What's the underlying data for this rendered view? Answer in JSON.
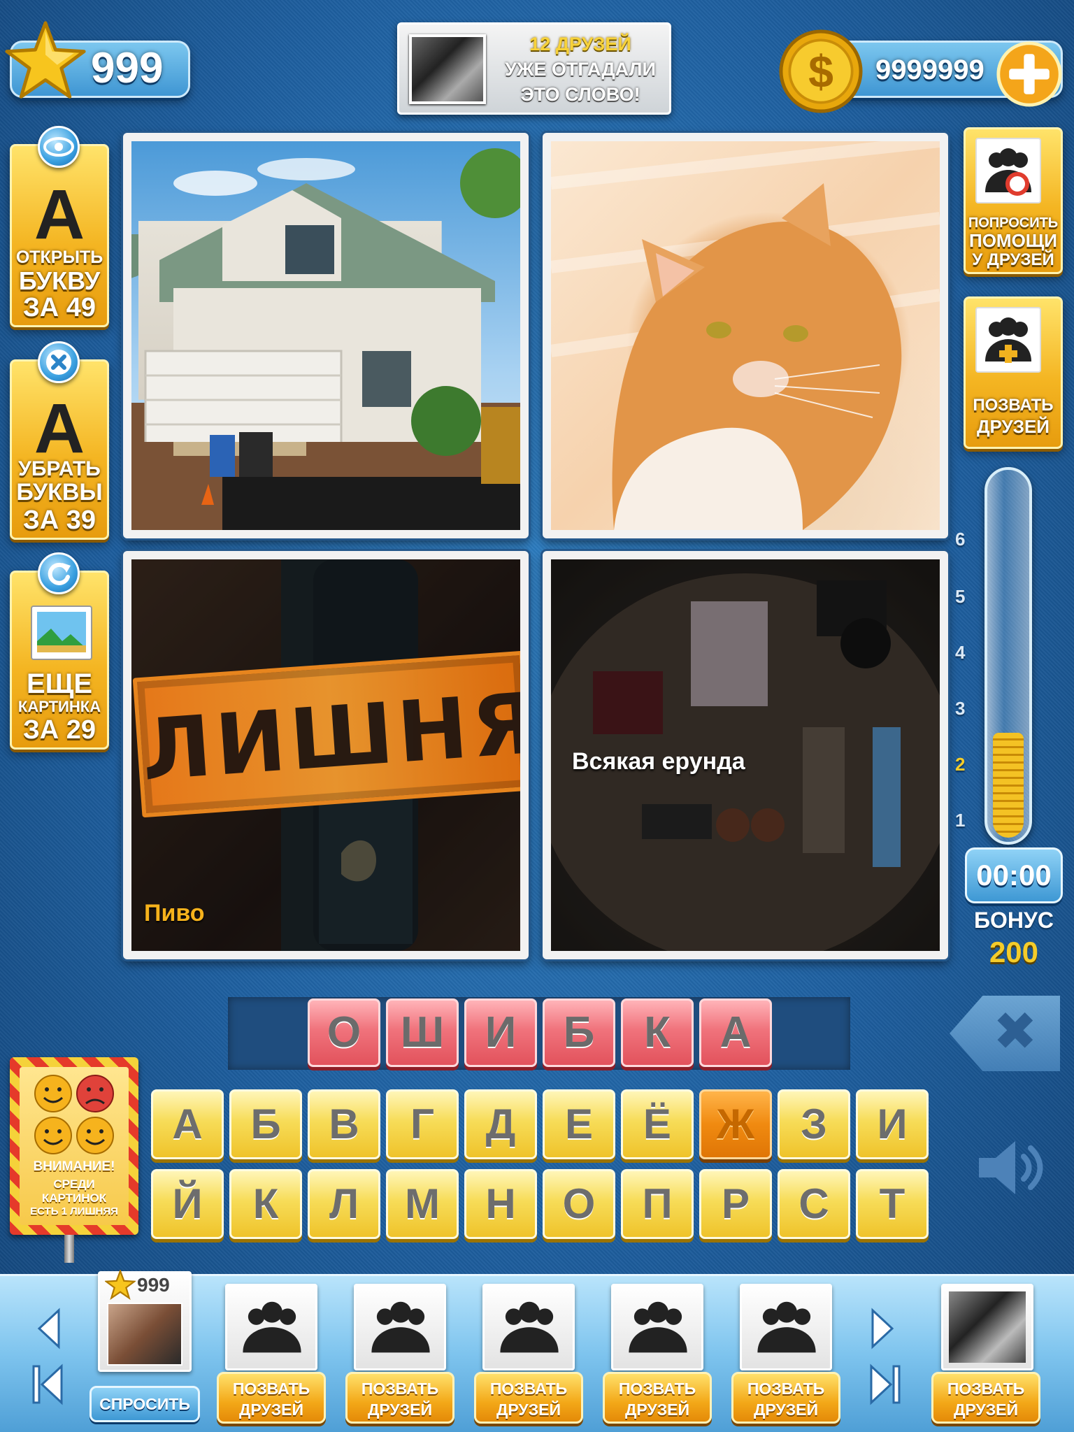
{
  "top": {
    "stars": "999",
    "coins": "9999999",
    "friends_notice": [
      "12 ДРУЗЕЙ",
      "УЖЕ ОТГАДАЛИ",
      "ЭТО СЛОВО!"
    ]
  },
  "left_powerups": [
    {
      "letter": "А",
      "icon": "eye-icon",
      "label": [
        "ОТКРЫТЬ",
        "БУКВУ",
        "ЗА 49"
      ]
    },
    {
      "letter": "А",
      "icon": "close-icon",
      "label": [
        "УБРАТЬ",
        "БУКВЫ",
        "ЗА 39"
      ]
    },
    {
      "icon": "refresh-icon",
      "label": [
        "ЕЩЕ",
        "КАРТИНКА",
        "ЗА 29"
      ]
    }
  ],
  "right_actions": [
    {
      "icon": "friends-help-icon",
      "label": [
        "ПОПРОСИТЬ",
        "ПОМОЩИ",
        "У ДРУЗЕЙ"
      ]
    },
    {
      "icon": "add-friends-icon",
      "label": [
        "ПОЗВАТЬ",
        "ДРУЗЕЙ"
      ]
    }
  ],
  "tiles": {
    "beer_stamp": "ЛИШНЯЯ",
    "beer_caption": "Пиво",
    "misc_caption": "Всякая ерунда"
  },
  "meter": {
    "ticks": [
      "6",
      "5",
      "4",
      "3",
      "2",
      "1"
    ],
    "level": 2,
    "timer": "00:00",
    "bonus_label": "БОНУС",
    "bonus_value": "200"
  },
  "answer": [
    "О",
    "Ш",
    "И",
    "Б",
    "К",
    "А"
  ],
  "keyboard": {
    "row1": [
      "А",
      "Б",
      "В",
      "Г",
      "Д",
      "Е",
      "Ё",
      "Ж",
      "З",
      "И"
    ],
    "row2": [
      "Й",
      "К",
      "Л",
      "М",
      "Н",
      "О",
      "П",
      "Р",
      "С",
      "Т"
    ],
    "selected": "Ж"
  },
  "warning": {
    "title": "ВНИМАНИЕ!",
    "text": [
      "СРЕДИ",
      "КАРТИНОК",
      "ЕСТЬ 1 ЛИШНЯЯ"
    ]
  },
  "bottom": {
    "player_stars": "999",
    "ask_label": "СПРОСИТЬ",
    "invite_label": [
      "ПОЗВАТЬ",
      "ДРУЗЕЙ"
    ]
  }
}
